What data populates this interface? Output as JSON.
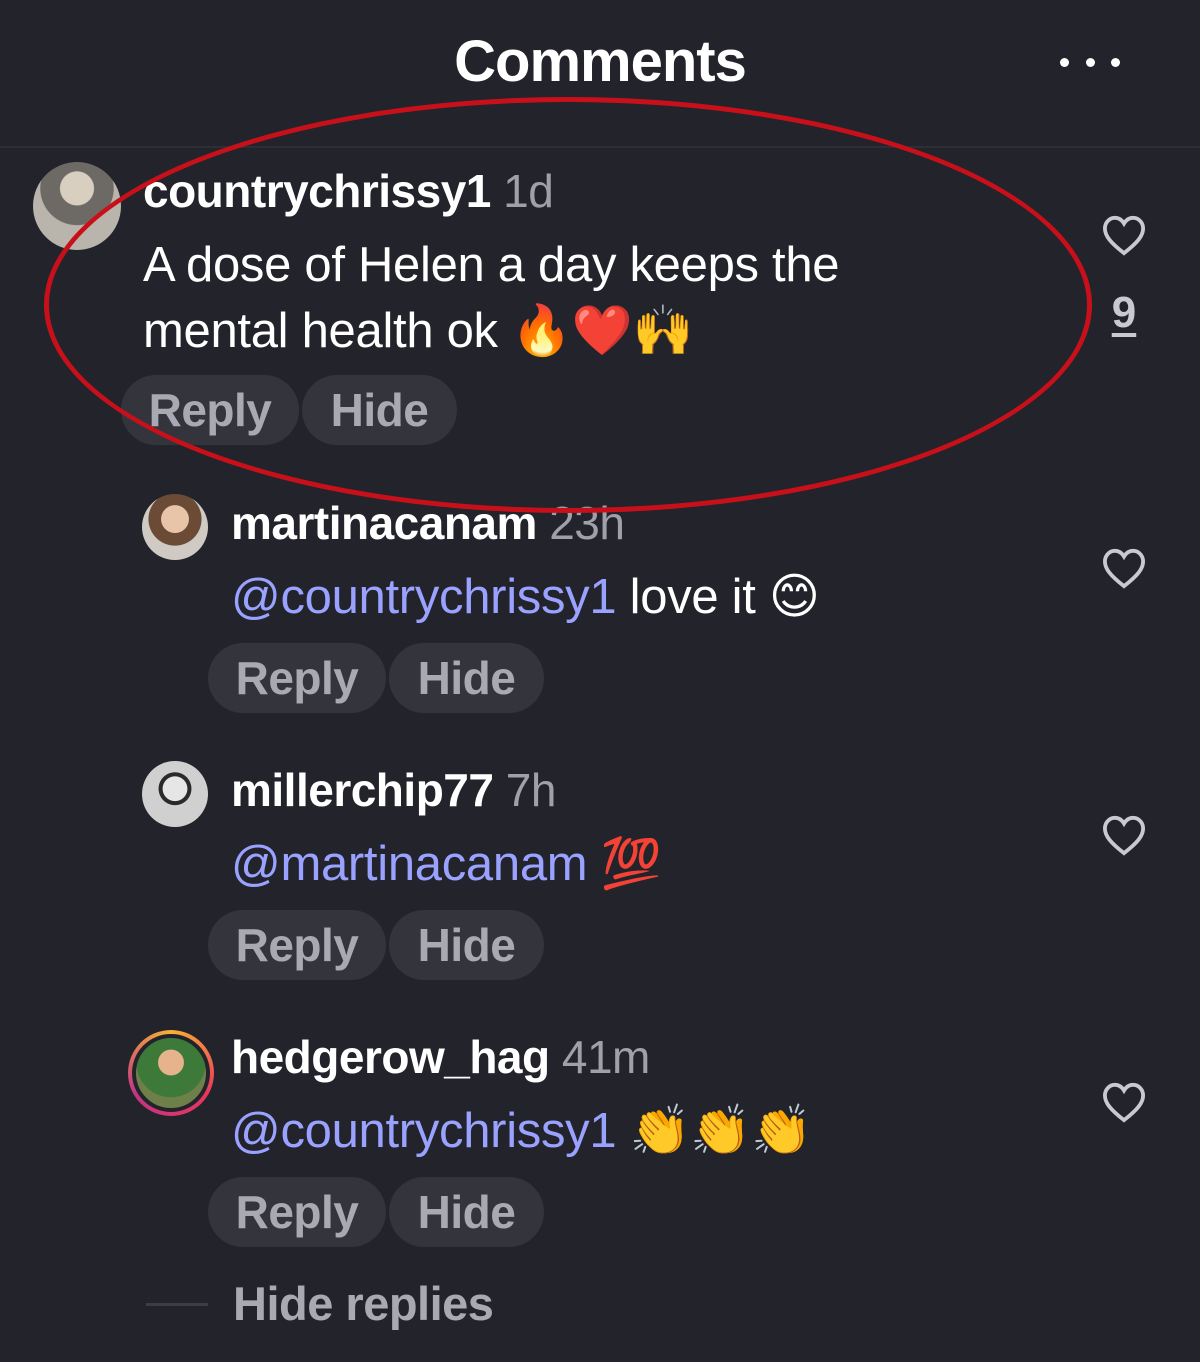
{
  "header": {
    "title": "Comments"
  },
  "comments": [
    {
      "username": "countrychrissy1",
      "time": "1d",
      "text_line1": "A dose of Helen a day keeps the",
      "text_line2": "mental health ok 🔥❤️🙌",
      "reply_label": "Reply",
      "hide_label": "Hide",
      "like_count": "9"
    },
    {
      "username": "martinacanam",
      "time": "23h",
      "mention": "@countrychrissy1",
      "text": "love it 😊",
      "reply_label": "Reply",
      "hide_label": "Hide"
    },
    {
      "username": "millerchip77",
      "time": "7h",
      "mention": "@martinacanam",
      "text": "💯",
      "reply_label": "Reply",
      "hide_label": "Hide"
    },
    {
      "username": "hedgerow_hag",
      "time": "41m",
      "mention": "@countrychrissy1",
      "text": "👏👏👏",
      "reply_label": "Reply",
      "hide_label": "Hide"
    }
  ],
  "footer": {
    "hide_replies_label": "Hide replies"
  },
  "colors": {
    "background": "#23232b",
    "mention": "#9aa2ff",
    "pill": "#34343d",
    "highlight_ellipse": "#c8101a"
  }
}
